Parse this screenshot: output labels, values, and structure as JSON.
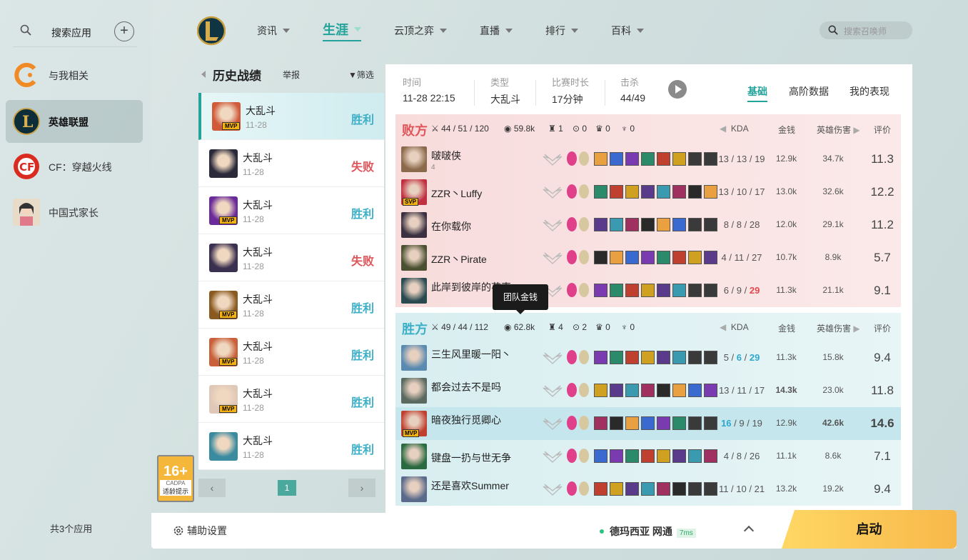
{
  "sidebar": {
    "search_label": "搜索应用",
    "apps": [
      {
        "name": "与我相关",
        "icon": "related-icon",
        "color": "#f08a24"
      },
      {
        "name": "英雄联盟",
        "icon": "lol-icon",
        "color": "#1c4f63"
      },
      {
        "name": "CF：穿越火线",
        "icon": "cf-icon",
        "color": "#d92b20"
      },
      {
        "name": "中国式家长",
        "icon": "chinese-parents-icon",
        "color": "#c9b8a0"
      }
    ],
    "count_label": "共3个应用",
    "age_badge": {
      "rating": "16+",
      "org": "CADPA",
      "label": "适龄提示"
    }
  },
  "nav": {
    "items": [
      "资讯",
      "生涯",
      "云顶之弈",
      "直播",
      "排行",
      "百科"
    ],
    "active": "生涯",
    "search_placeholder": "搜索召唤师"
  },
  "history": {
    "title": "历史战绩",
    "report": "举报",
    "filter": "筛选",
    "rows": [
      {
        "mode": "大乱斗",
        "date": "11-28",
        "result": "胜利",
        "win": true,
        "mvp": "MVP",
        "color": "#d05a3a"
      },
      {
        "mode": "大乱斗",
        "date": "11-28",
        "result": "失败",
        "win": false,
        "mvp": "",
        "color": "#2a2a3a"
      },
      {
        "mode": "大乱斗",
        "date": "11-28",
        "result": "胜利",
        "win": true,
        "mvp": "MVP",
        "color": "#6a2a9a"
      },
      {
        "mode": "大乱斗",
        "date": "11-28",
        "result": "失败",
        "win": false,
        "mvp": "",
        "color": "#3a3050"
      },
      {
        "mode": "大乱斗",
        "date": "11-28",
        "result": "胜利",
        "win": true,
        "mvp": "MVP",
        "color": "#8a5a20"
      },
      {
        "mode": "大乱斗",
        "date": "11-28",
        "result": "胜利",
        "win": true,
        "mvp": "MVP",
        "color": "#c8603a"
      },
      {
        "mode": "大乱斗",
        "date": "11-28",
        "result": "胜利",
        "win": true,
        "mvp": "MVP",
        "color": "#e0c8b8"
      },
      {
        "mode": "大乱斗",
        "date": "11-28",
        "result": "胜利",
        "win": true,
        "mvp": "",
        "color": "#3a8aa0"
      }
    ],
    "page": "1"
  },
  "match": {
    "time_label": "时间",
    "time": "11-28 22:15",
    "type_label": "类型",
    "type": "大乱斗",
    "duration_label": "比赛时长",
    "duration": "17分钟",
    "kills_label": "击杀",
    "kills": "44/49",
    "tabs": [
      "基础",
      "高阶数据",
      "我的表现"
    ],
    "col_kda": "KDA",
    "col_gold": "金钱",
    "col_dmg": "英雄伤害",
    "col_score": "评价",
    "tooltip": "团队金钱"
  },
  "teams": [
    {
      "name": "败方",
      "win": false,
      "kda": "44 / 51 / 120",
      "gold": "59.8k",
      "towers": "1",
      "inhib": "0",
      "baron": "0",
      "dragon": "0",
      "players": [
        {
          "name": "啵啵侠",
          "tag": "4",
          "badge": "",
          "kda": [
            "13",
            "13",
            "19"
          ],
          "kda_hl": -1,
          "gold": "12.9k",
          "dmg": "34.7k",
          "score": "11.3",
          "hl": false,
          "color": "#8a6a4a"
        },
        {
          "name": "ZZR丶Luffy",
          "tag": "",
          "badge": "SVP",
          "kda": [
            "13",
            "10",
            "17"
          ],
          "kda_hl": -1,
          "gold": "13.0k",
          "dmg": "32.6k",
          "score": "12.2",
          "hl": false,
          "color": "#c03040"
        },
        {
          "name": "在你载你",
          "tag": "",
          "badge": "",
          "kda": [
            "8",
            "8",
            "28"
          ],
          "kda_hl": -1,
          "gold": "12.0k",
          "dmg": "29.1k",
          "score": "11.2",
          "hl": false,
          "color": "#3a3040"
        },
        {
          "name": "ZZR丶Pirate",
          "tag": "",
          "badge": "",
          "kda": [
            "4",
            "11",
            "27"
          ],
          "kda_hl": -1,
          "gold": "10.7k",
          "dmg": "8.9k",
          "score": "5.7",
          "hl": false,
          "color": "#4a5030"
        },
        {
          "name": "此岸到彼岸的花事",
          "tag": "",
          "badge": "",
          "kda": [
            "6",
            "9",
            "29"
          ],
          "kda_hl": 2,
          "gold": "11.3k",
          "dmg": "21.1k",
          "score": "9.1",
          "hl": false,
          "color": "#2a4a50"
        }
      ]
    },
    {
      "name": "胜方",
      "win": true,
      "kda": "49 / 44 / 112",
      "gold": "62.8k",
      "towers": "4",
      "inhib": "2",
      "baron": "0",
      "dragon": "0",
      "players": [
        {
          "name": "三生风里暖一阳丶",
          "tag": "",
          "badge": "",
          "kda": [
            "5",
            "6",
            "29"
          ],
          "kda_hl": 12,
          "gold": "11.3k",
          "dmg": "15.8k",
          "score": "9.4",
          "hl": false,
          "color": "#5a8ab0"
        },
        {
          "name": "都会过去不是吗",
          "tag": "",
          "badge": "",
          "kda": [
            "13",
            "11",
            "17"
          ],
          "kda_hl": -1,
          "gold": "14.3k",
          "gold_hl": true,
          "dmg": "23.0k",
          "score": "11.8",
          "hl": false,
          "color": "#5a6a60"
        },
        {
          "name": "暗夜独行觅卿心",
          "tag": "",
          "badge": "MVP",
          "kda": [
            "16",
            "9",
            "19"
          ],
          "kda_hl": 0,
          "gold": "12.9k",
          "dmg": "42.6k",
          "dmg_hl": true,
          "score": "14.6",
          "score_hl": true,
          "hl": true,
          "color": "#c04030"
        },
        {
          "name": "键盘一扔与世无争",
          "tag": "",
          "badge": "",
          "kda": [
            "4",
            "8",
            "26"
          ],
          "kda_hl": -1,
          "gold": "11.1k",
          "dmg": "8.6k",
          "score": "7.1",
          "hl": false,
          "color": "#2a6a40"
        },
        {
          "name": "还是喜欢Summer",
          "tag": "",
          "badge": "",
          "kda": [
            "11",
            "10",
            "21"
          ],
          "kda_hl": -1,
          "gold": "13.2k",
          "dmg": "19.2k",
          "score": "9.4",
          "hl": false,
          "color": "#5a6a8a"
        }
      ]
    }
  ],
  "bottom": {
    "settings": "辅助设置",
    "server": "德玛西亚 网通",
    "ping": "7ms",
    "launch": "启动"
  }
}
